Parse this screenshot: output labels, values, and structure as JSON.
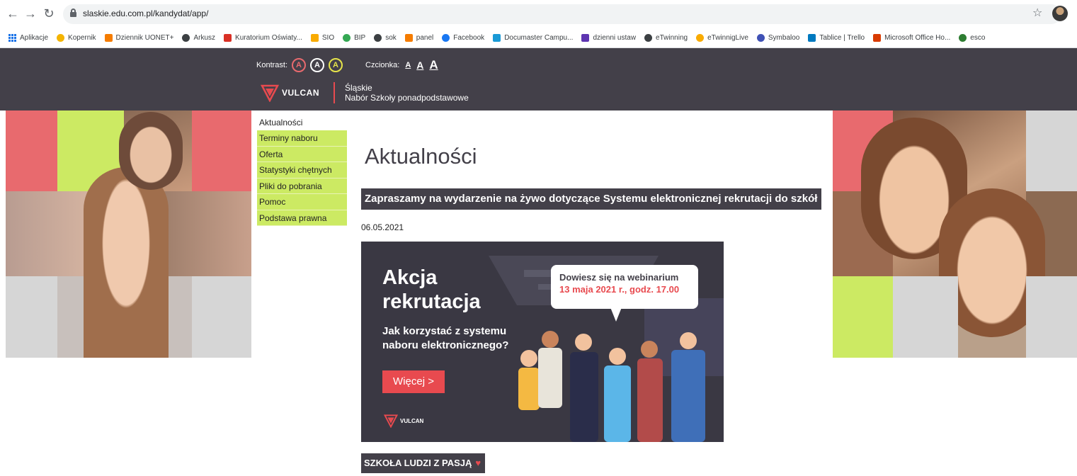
{
  "browser": {
    "url": "slaskie.edu.com.pl/kandydat/app/",
    "back_icon": "arrow-left",
    "forward_icon": "arrow-right",
    "reload_icon": "reload",
    "star_icon": "star"
  },
  "bookmarks": [
    {
      "label": "Aplikacje",
      "icon": "apps-grid",
      "color": "#1a73e8"
    },
    {
      "label": "Kopernik",
      "icon": "swirl",
      "color": "#f4b400"
    },
    {
      "label": "Dziennik UONET+",
      "icon": "plus-square",
      "color": "#f57c00"
    },
    {
      "label": "Arkusz",
      "icon": "globe",
      "color": "#3c4043"
    },
    {
      "label": "Kuratorium Oświaty...",
      "icon": "emblem",
      "color": "#d93025"
    },
    {
      "label": "SIO",
      "icon": "sio",
      "color": "#f9ab00"
    },
    {
      "label": "BIP",
      "icon": "bip",
      "color": "#34a853"
    },
    {
      "label": "sok",
      "icon": "globe",
      "color": "#3c4043"
    },
    {
      "label": "panel",
      "icon": "square",
      "color": "#f57c00"
    },
    {
      "label": "Facebook",
      "icon": "facebook",
      "color": "#1877f2"
    },
    {
      "label": "Documaster Campu...",
      "icon": "square",
      "color": "#1a9ad6"
    },
    {
      "label": "dzienni ustaw",
      "icon": "check-mark",
      "color": "#5e35b1"
    },
    {
      "label": "eTwinning",
      "icon": "globe",
      "color": "#3c4043"
    },
    {
      "label": "eTwinnigLive",
      "icon": "twinning",
      "color": "#f9ab00"
    },
    {
      "label": "Symbaloo",
      "icon": "circle",
      "color": "#3f51b5"
    },
    {
      "label": "Tablice | Trello",
      "icon": "trello",
      "color": "#0079bf"
    },
    {
      "label": "Microsoft Office Ho...",
      "icon": "office",
      "color": "#d83b01"
    },
    {
      "label": "esco",
      "icon": "esco",
      "color": "#2e7d32"
    }
  ],
  "header": {
    "contrast_label": "Kontrast:",
    "contrast_options": [
      "A",
      "A",
      "A"
    ],
    "font_label": "Czcionka:",
    "font_options": [
      "A",
      "A",
      "A"
    ],
    "logo_text": "VULCAN",
    "region_name": "Śląskie",
    "region_sub": "Nabór Szkoły ponadpodstawowe"
  },
  "nav": [
    {
      "label": "Aktualności",
      "active": true
    },
    {
      "label": "Terminy naboru",
      "active": false
    },
    {
      "label": "Oferta",
      "active": false
    },
    {
      "label": "Statystyki chętnych",
      "active": false
    },
    {
      "label": "Pliki do pobrania",
      "active": false
    },
    {
      "label": "Pomoc",
      "active": false
    },
    {
      "label": "Podstawa prawna",
      "active": false
    }
  ],
  "main": {
    "page_title": "Aktualności",
    "news_heading": "Zapraszamy na wydarzenie na żywo dotyczące Systemu elektronicznej rekrutacji do szkół",
    "news_date": "06.05.2021",
    "banner": {
      "title_line1": "Akcja",
      "title_line2": "rekrutacja",
      "subtitle_line1": "Jak korzystać z systemu",
      "subtitle_line2": "naboru elektronicznego?",
      "button": "Więcej >",
      "bubble_line1": "Dowiesz się na webinarium",
      "bubble_line2": "13 maja 2021 r., godz. 17.00",
      "logo_text": "VULCAN"
    },
    "second_heading": "SZKOŁA LUDZI Z PASJĄ"
  },
  "colors": {
    "header_bg": "#434049",
    "nav_green": "#ccea63",
    "accent_red": "#e84a4f",
    "tile_pink": "#e86a6e",
    "tile_grey": "#d6d6d6"
  }
}
